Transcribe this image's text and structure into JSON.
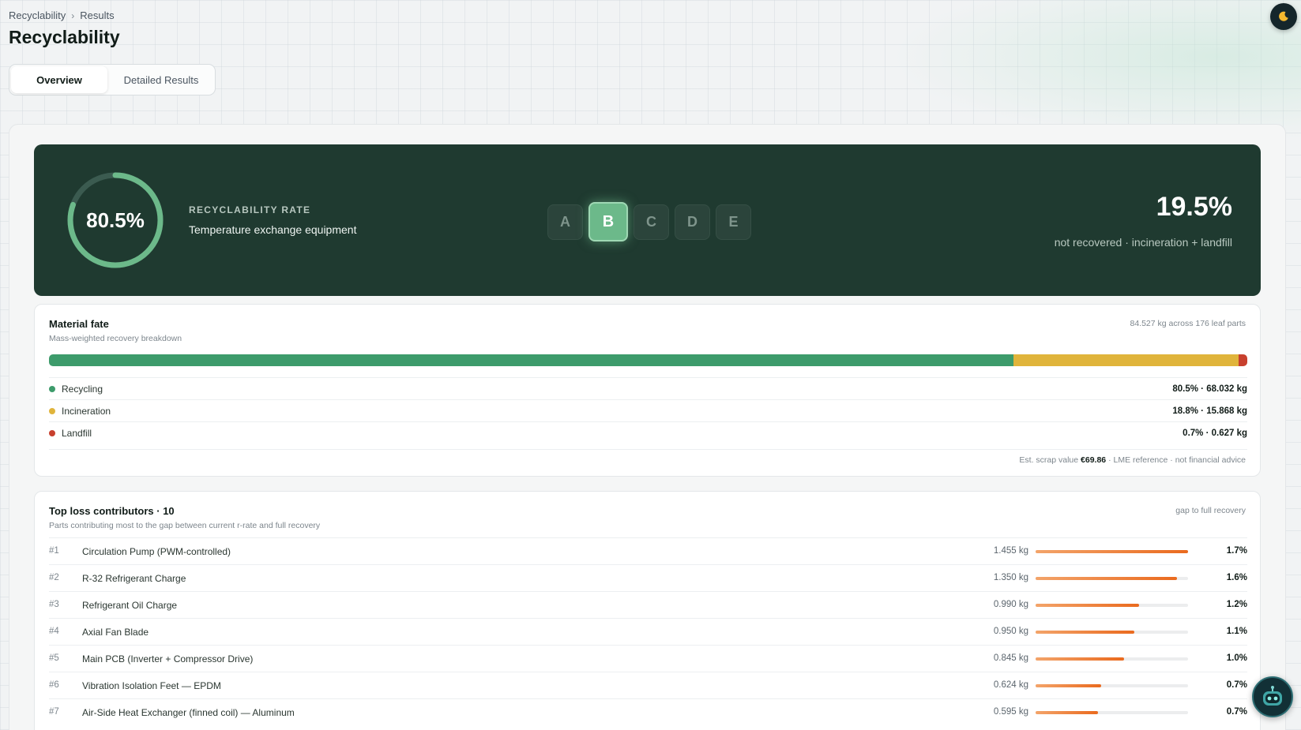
{
  "breadcrumb": {
    "root": "Recyclability",
    "separator": "›",
    "current": "Results"
  },
  "page": {
    "title": "Recyclability"
  },
  "tabs": [
    {
      "label": "Overview",
      "active": true
    },
    {
      "label": "Detailed Results",
      "active": false
    }
  ],
  "hero": {
    "rate_value": "80.5%",
    "rate_fraction": 0.805,
    "rate_label": "RECYCLABILITY RATE",
    "category": "Temperature exchange equipment",
    "grades": [
      "A",
      "B",
      "C",
      "D",
      "E"
    ],
    "active_grade": "B",
    "loss_value": "19.5%",
    "loss_text": "not recovered · incineration + landfill"
  },
  "material_fate": {
    "title": "Material fate",
    "subtitle": "Mass-weighted recovery breakdown",
    "meta": "84.527 kg across 176 leaf parts",
    "rows": [
      {
        "name": "Recycling",
        "value": "80.5% · 68.032 kg",
        "share": 80.5,
        "color": "#3d9b6b"
      },
      {
        "name": "Incineration",
        "value": "18.8% · 15.868 kg",
        "share": 18.8,
        "color": "#e0b43b"
      },
      {
        "name": "Landfill",
        "value": "0.7% · 0.627 kg",
        "share": 0.7,
        "color": "#c8402e"
      }
    ],
    "scrap_prefix": "Est. scrap value",
    "scrap_value": "€69.86",
    "scrap_suffix": "· LME reference · not financial advice"
  },
  "loss": {
    "title": "Top loss contributors · 10",
    "subtitle": "Parts contributing most to the gap between current r-rate and full recovery",
    "meta": "gap to full recovery",
    "rows": [
      {
        "rank": "#1",
        "name": "Circulation Pump (PWM-controlled)",
        "mass": "1.455 kg",
        "pct": "1.7%",
        "bar": 1.0
      },
      {
        "rank": "#2",
        "name": "R-32 Refrigerant Charge",
        "mass": "1.350 kg",
        "pct": "1.6%",
        "bar": 0.93
      },
      {
        "rank": "#3",
        "name": "Refrigerant Oil Charge",
        "mass": "0.990 kg",
        "pct": "1.2%",
        "bar": 0.68
      },
      {
        "rank": "#4",
        "name": "Axial Fan Blade",
        "mass": "0.950 kg",
        "pct": "1.1%",
        "bar": 0.65
      },
      {
        "rank": "#5",
        "name": "Main PCB (Inverter + Compressor Drive)",
        "mass": "0.845 kg",
        "pct": "1.0%",
        "bar": 0.58
      },
      {
        "rank": "#6",
        "name": "Vibration Isolation Feet — EPDM",
        "mass": "0.624 kg",
        "pct": "0.7%",
        "bar": 0.43
      },
      {
        "rank": "#7",
        "name": "Air-Side Heat Exchanger (finned coil) — Aluminum",
        "mass": "0.595 kg",
        "pct": "0.7%",
        "bar": 0.41
      }
    ]
  },
  "icons": {
    "theme": "moon-icon",
    "assistant": "robot-icon"
  },
  "colors": {
    "hero_bg": "#1f3a30",
    "ring": "#6cb98a",
    "accent_orange": "#ea6a1e"
  }
}
